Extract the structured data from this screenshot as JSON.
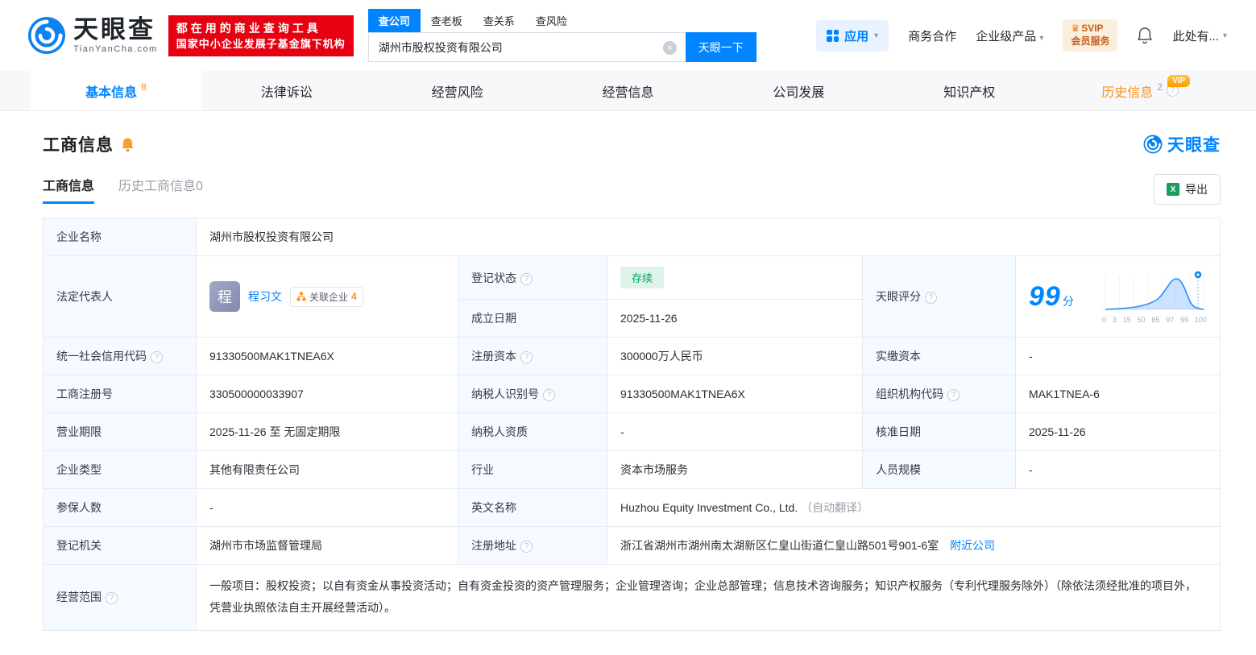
{
  "icons": {
    "question": "?",
    "caret": "▾",
    "clear": "×",
    "crown": "♛",
    "excel": "X",
    "avatar_char": "程"
  },
  "header": {
    "logo": {
      "name": "天眼查",
      "domain": "TianYanCha.com"
    },
    "promo": {
      "line1": "都在用的商业查询工具",
      "line2": "国家中小企业发展子基金旗下机构"
    },
    "search": {
      "tabs": [
        {
          "label": "查公司"
        },
        {
          "label": "查老板"
        },
        {
          "label": "查关系"
        },
        {
          "label": "查风险"
        }
      ],
      "value": "湖州市股权投资有限公司",
      "button": "天眼一下"
    },
    "apps_label": "应用",
    "links": [
      {
        "label": "商务合作"
      },
      {
        "label": "企业级产品"
      }
    ],
    "svip": {
      "line1": "SVIP",
      "line2": "会员服务"
    },
    "account": "此处有..."
  },
  "nav": {
    "tabs": [
      {
        "label": "基本信息",
        "count": "8"
      },
      {
        "label": "法律诉讼"
      },
      {
        "label": "经营风险"
      },
      {
        "label": "经营信息"
      },
      {
        "label": "公司发展"
      },
      {
        "label": "知识产权"
      },
      {
        "label": "历史信息",
        "count": "2",
        "vip": "VIP"
      }
    ]
  },
  "section": {
    "title": "工商信息",
    "brand": "天眼查",
    "subtabs": [
      {
        "label": "工商信息"
      },
      {
        "label": "历史工商信息0"
      }
    ],
    "export_label": "导出"
  },
  "info": {
    "company_name": {
      "label": "企业名称",
      "value": "湖州市股权投资有限公司"
    },
    "legal_rep": {
      "label": "法定代表人",
      "avatar": "程",
      "name": "程习文",
      "related_label": "关联企业",
      "related_count": "4"
    },
    "reg_status": {
      "label": "登记状态",
      "value": "存续"
    },
    "score": {
      "label": "天眼评分",
      "value": "99",
      "unit": "分",
      "ticks": [
        "0",
        "3",
        "15",
        "50",
        "85",
        "97",
        "99",
        "100"
      ]
    },
    "est_date": {
      "label": "成立日期",
      "value": "2025-11-26"
    },
    "credit_code": {
      "label": "统一社会信用代码",
      "value": "91330500MAK1TNEA6X"
    },
    "reg_capital": {
      "label": "注册资本",
      "value": "300000万人民币"
    },
    "paid_capital": {
      "label": "实缴资本",
      "value": "-"
    },
    "reg_number": {
      "label": "工商注册号",
      "value": "330500000033907"
    },
    "taxpayer_id": {
      "label": "纳税人识别号",
      "value": "91330500MAK1TNEA6X"
    },
    "org_code": {
      "label": "组织机构代码",
      "value": "MAK1TNEA-6"
    },
    "business_term": {
      "label": "营业期限",
      "value": "2025-11-26 至 无固定期限"
    },
    "taxpayer_qual": {
      "label": "纳税人资质",
      "value": "-"
    },
    "approval_date": {
      "label": "核准日期",
      "value": "2025-11-26"
    },
    "company_type": {
      "label": "企业类型",
      "value": "其他有限责任公司"
    },
    "industry": {
      "label": "行业",
      "value": "资本市场服务"
    },
    "staff_size": {
      "label": "人员规模",
      "value": "-"
    },
    "insured_count": {
      "label": "参保人数",
      "value": "-"
    },
    "english_name": {
      "label": "英文名称",
      "value": "Huzhou Equity Investment Co., Ltd.",
      "note": "（自动翻译）"
    },
    "reg_authority": {
      "label": "登记机关",
      "value": "湖州市市场监督管理局"
    },
    "reg_address": {
      "label": "注册地址",
      "value": "浙江省湖州市湖州南太湖新区仁皇山街道仁皇山路501号901-6室",
      "nearby": "附近公司"
    },
    "business_scope": {
      "label": "经营范围",
      "value": "一般项目：股权投资；以自有资金从事投资活动；自有资金投资的资产管理服务；企业管理咨询；企业总部管理；信息技术咨询服务；知识产权服务（专利代理服务除外）（除依法须经批准的项目外，凭营业执照依法自主开展经营活动）。"
    }
  }
}
